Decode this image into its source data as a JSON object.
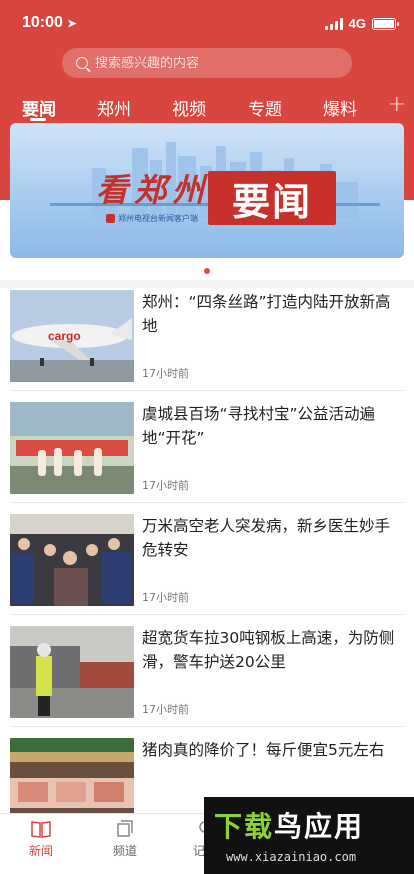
{
  "status_bar": {
    "time": "10:00",
    "network": "4G"
  },
  "search": {
    "placeholder": "搜索感兴趣的内容"
  },
  "tabs": [
    {
      "label": "要闻",
      "active": true
    },
    {
      "label": "郑州"
    },
    {
      "label": "视频"
    },
    {
      "label": "专题"
    },
    {
      "label": "爆料"
    }
  ],
  "tab_add_icon": "plus-icon",
  "banner": {
    "calligraphy": "看郑州",
    "headline": "要闻",
    "subtitle": "郑州电视台新闻客户端"
  },
  "news": [
    {
      "title": "郑州：“四条丝路”打造内陆开放新高地",
      "time": "17小时前"
    },
    {
      "title": "虞城县百场“寻找村宝”公益活动遍地“开花”",
      "time": "17小时前"
    },
    {
      "title": "万米高空老人突发病，新乡医生妙手危转安",
      "time": "17小时前"
    },
    {
      "title": "超宽货车拉30吨钢板上高速，为防侧滑，警车护送20公里",
      "time": "17小时前"
    },
    {
      "title": "猪肉真的降价了！每斤便宜5元左右",
      "time": ""
    }
  ],
  "tabbar": [
    {
      "label": "新闻",
      "icon": "book-icon",
      "active": true
    },
    {
      "label": "频道",
      "icon": "channel-icon"
    },
    {
      "label": "记者",
      "icon": "reporter-icon"
    }
  ],
  "watermark": {
    "brand": "下载鸟应用",
    "url": "www.xiazainiao.com"
  },
  "colors": {
    "brand_red": "#d8463f",
    "watermark_green": "#8fd13a"
  }
}
